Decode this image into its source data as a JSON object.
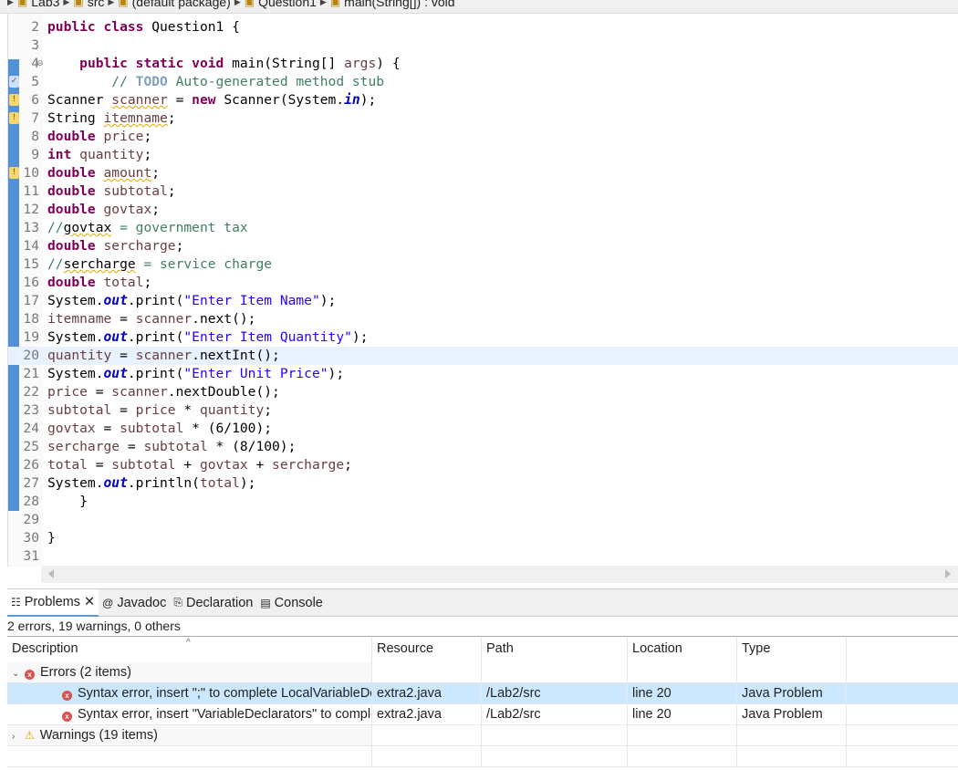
{
  "breadcrumb": [
    "Lab3",
    "src",
    "(default package)",
    "Question1",
    "main(String[]) : void"
  ],
  "editor": {
    "current_line": 20,
    "lines": [
      {
        "n": "2",
        "t": [
          [
            "k",
            "public class"
          ],
          [
            "p",
            " Question1 {"
          ]
        ]
      },
      {
        "n": "3",
        "t": []
      },
      {
        "n": "4",
        "fold": true,
        "t": [
          [
            "p",
            "    "
          ],
          [
            "k",
            "public static void"
          ],
          [
            "p",
            " main(String[] "
          ],
          [
            "v",
            "args"
          ],
          [
            "p",
            ") {"
          ]
        ]
      },
      {
        "n": "5",
        "marker": "task",
        "t": [
          [
            "p",
            "        "
          ],
          [
            "c",
            "// "
          ],
          [
            "t",
            "TODO"
          ],
          [
            "c",
            " Auto-generated method stub"
          ]
        ]
      },
      {
        "n": "6",
        "marker": "warn",
        "t": [
          [
            "p",
            "Scanner "
          ],
          [
            "u",
            "scanner"
          ],
          [
            "p",
            " = "
          ],
          [
            "k",
            "new"
          ],
          [
            "p",
            " Scanner(System."
          ],
          [
            "f",
            "in"
          ],
          [
            "p",
            ");"
          ]
        ]
      },
      {
        "n": "7",
        "marker": "warn",
        "t": [
          [
            "p",
            "String "
          ],
          [
            "u",
            "itemname"
          ],
          [
            "p",
            ";"
          ]
        ]
      },
      {
        "n": "8",
        "t": [
          [
            "k",
            "double"
          ],
          [
            "p",
            " "
          ],
          [
            "v",
            "price"
          ],
          [
            "p",
            ";"
          ]
        ]
      },
      {
        "n": "9",
        "t": [
          [
            "k",
            "int"
          ],
          [
            "p",
            " "
          ],
          [
            "v",
            "quantity"
          ],
          [
            "p",
            ";"
          ]
        ]
      },
      {
        "n": "10",
        "marker": "warn",
        "t": [
          [
            "k",
            "double"
          ],
          [
            "p",
            " "
          ],
          [
            "u",
            "amount"
          ],
          [
            "p",
            ";"
          ]
        ]
      },
      {
        "n": "11",
        "t": [
          [
            "k",
            "double"
          ],
          [
            "p",
            " "
          ],
          [
            "v",
            "subtotal"
          ],
          [
            "p",
            ";"
          ]
        ]
      },
      {
        "n": "12",
        "t": [
          [
            "k",
            "double"
          ],
          [
            "p",
            " "
          ],
          [
            "v",
            "govtax"
          ],
          [
            "p",
            ";"
          ]
        ]
      },
      {
        "n": "13",
        "t": [
          [
            "c",
            "//"
          ],
          [
            "cu",
            "govtax"
          ],
          [
            "c",
            " = government tax"
          ]
        ]
      },
      {
        "n": "14",
        "t": [
          [
            "k",
            "double"
          ],
          [
            "p",
            " "
          ],
          [
            "v",
            "sercharge"
          ],
          [
            "p",
            ";"
          ]
        ]
      },
      {
        "n": "15",
        "t": [
          [
            "c",
            "//"
          ],
          [
            "cu",
            "sercharge"
          ],
          [
            "c",
            " = service charge"
          ]
        ]
      },
      {
        "n": "16",
        "t": [
          [
            "k",
            "double"
          ],
          [
            "p",
            " "
          ],
          [
            "v",
            "total"
          ],
          [
            "p",
            ";"
          ]
        ]
      },
      {
        "n": "17",
        "t": [
          [
            "p",
            "System."
          ],
          [
            "f",
            "out"
          ],
          [
            "p",
            ".print("
          ],
          [
            "s",
            "\"Enter Item Name\""
          ],
          [
            "p",
            ");"
          ]
        ]
      },
      {
        "n": "18",
        "t": [
          [
            "v",
            "itemname"
          ],
          [
            "p",
            " = "
          ],
          [
            "v",
            "scanner"
          ],
          [
            "p",
            ".next();"
          ]
        ]
      },
      {
        "n": "19",
        "t": [
          [
            "p",
            "System."
          ],
          [
            "f",
            "out"
          ],
          [
            "p",
            ".print("
          ],
          [
            "s",
            "\"Enter Item Quantity\""
          ],
          [
            "p",
            ");"
          ]
        ]
      },
      {
        "n": "20",
        "t": [
          [
            "v",
            "quantity"
          ],
          [
            "p",
            " = "
          ],
          [
            "v",
            "scanner"
          ],
          [
            "p",
            ".nextInt();"
          ]
        ]
      },
      {
        "n": "21",
        "t": [
          [
            "p",
            "System."
          ],
          [
            "f",
            "out"
          ],
          [
            "p",
            ".print("
          ],
          [
            "s",
            "\"Enter Unit Price\""
          ],
          [
            "p",
            ");"
          ]
        ]
      },
      {
        "n": "22",
        "t": [
          [
            "v",
            "price"
          ],
          [
            "p",
            " = "
          ],
          [
            "v",
            "scanner"
          ],
          [
            "p",
            ".nextDouble();"
          ]
        ]
      },
      {
        "n": "23",
        "t": [
          [
            "v",
            "subtotal"
          ],
          [
            "p",
            " = "
          ],
          [
            "v",
            "price"
          ],
          [
            "p",
            " * "
          ],
          [
            "v",
            "quantity"
          ],
          [
            "p",
            ";"
          ]
        ]
      },
      {
        "n": "24",
        "t": [
          [
            "v",
            "govtax"
          ],
          [
            "p",
            " = "
          ],
          [
            "v",
            "subtotal"
          ],
          [
            "p",
            " * (6/100);"
          ]
        ]
      },
      {
        "n": "25",
        "t": [
          [
            "v",
            "sercharge"
          ],
          [
            "p",
            " = "
          ],
          [
            "v",
            "subtotal"
          ],
          [
            "p",
            " * (8/100);"
          ]
        ]
      },
      {
        "n": "26",
        "t": [
          [
            "v",
            "total"
          ],
          [
            "p",
            " = "
          ],
          [
            "v",
            "subtotal"
          ],
          [
            "p",
            " + "
          ],
          [
            "v",
            "govtax"
          ],
          [
            "p",
            " + "
          ],
          [
            "v",
            "sercharge"
          ],
          [
            "p",
            ";"
          ]
        ]
      },
      {
        "n": "27",
        "t": [
          [
            "p",
            "System."
          ],
          [
            "f",
            "out"
          ],
          [
            "p",
            ".println("
          ],
          [
            "v",
            "total"
          ],
          [
            "p",
            ");"
          ]
        ]
      },
      {
        "n": "28",
        "t": [
          [
            "p",
            "    }"
          ]
        ]
      },
      {
        "n": "29",
        "t": []
      },
      {
        "n": "30",
        "t": [
          [
            "p",
            "}"
          ]
        ]
      },
      {
        "n": "31",
        "t": []
      }
    ]
  },
  "panel": {
    "tabs": [
      {
        "label": "Problems",
        "icon": "problems-icon",
        "active": true
      },
      {
        "label": "Javadoc",
        "icon": "javadoc-icon"
      },
      {
        "label": "Declaration",
        "icon": "declaration-icon"
      },
      {
        "label": "Console",
        "icon": "console-icon"
      }
    ],
    "summary": "2 errors, 19 warnings, 0 others",
    "columns": [
      "Description",
      "Resource",
      "Path",
      "Location",
      "Type"
    ],
    "errors_group": "Errors (2 items)",
    "errors": [
      {
        "description": "Syntax error, insert \";\" to complete LocalVariableDeclarationStatement",
        "resource": "extra2.java",
        "path": "/Lab2/src",
        "location": "line 20",
        "type": "Java Problem",
        "selected": true
      },
      {
        "description": "Syntax error, insert \"VariableDeclarators\" to complete LocalVariableDeclaration",
        "resource": "extra2.java",
        "path": "/Lab2/src",
        "location": "line 20",
        "type": "Java Problem"
      }
    ],
    "warnings_group": "Warnings (19 items)"
  },
  "colors": {
    "keyword": "#7f0055",
    "string": "#2a00ff",
    "comment": "#3f7f5f",
    "selection": "#cce8ff",
    "current_line": "#e8f2fe"
  }
}
